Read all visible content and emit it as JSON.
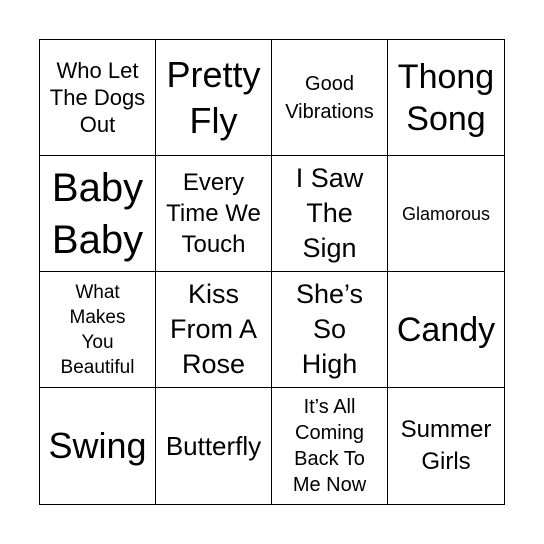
{
  "cells": [
    {
      "lines": [
        "Who Let",
        "The Dogs",
        "Out"
      ]
    },
    {
      "lines": [
        "Pretty",
        "Fly"
      ]
    },
    {
      "lines": [
        "Good",
        "Vibrations"
      ]
    },
    {
      "lines": [
        "Thong",
        "Song"
      ]
    },
    {
      "lines": [
        "Baby",
        "Baby"
      ]
    },
    {
      "lines": [
        "Every",
        "Time We",
        "Touch"
      ]
    },
    {
      "lines": [
        "I Saw",
        "The",
        "Sign"
      ]
    },
    {
      "lines": [
        "Glamorous"
      ]
    },
    {
      "lines": [
        "What",
        "Makes",
        "You",
        "Beautiful"
      ]
    },
    {
      "lines": [
        "Kiss",
        "From A",
        "Rose"
      ]
    },
    {
      "lines": [
        "She’s",
        "So",
        "High"
      ]
    },
    {
      "lines": [
        "Candy"
      ]
    },
    {
      "lines": [
        "Swing"
      ]
    },
    {
      "lines": [
        "Butterfly"
      ]
    },
    {
      "lines": [
        "It’s All",
        "Coming",
        "Back To",
        "Me Now"
      ]
    },
    {
      "lines": [
        "Summer",
        "Girls"
      ]
    }
  ]
}
